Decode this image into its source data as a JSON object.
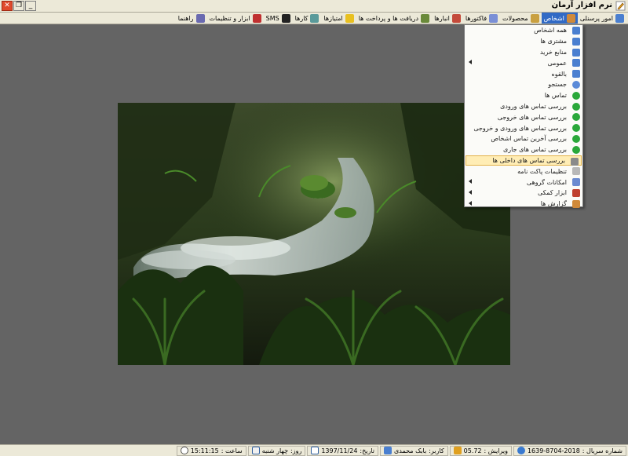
{
  "window": {
    "title": "نرم افزار آرمان",
    "close_glyph": "✕",
    "restore_glyph": "❐",
    "minimize_glyph": "_"
  },
  "menubar": {
    "items": [
      {
        "label": "امور پرسنلی",
        "icon": "people-icon",
        "color": "#4a7fd0"
      },
      {
        "label": "اشخاص",
        "icon": "people-icon",
        "color": "#d08a3a"
      },
      {
        "label": "محصولات",
        "icon": "box-icon",
        "color": "#c9a040"
      },
      {
        "label": "فاکتورها",
        "icon": "invoice-icon",
        "color": "#7a8fd6"
      },
      {
        "label": "انبارها",
        "icon": "warehouse-icon",
        "color": "#c44a3a"
      },
      {
        "label": "دریافت ها و پرداخت ها",
        "icon": "money-icon",
        "color": "#6a8a3a"
      },
      {
        "label": "امتیازها",
        "icon": "star-icon",
        "color": "#e8c020"
      },
      {
        "label": "کارها",
        "icon": "tasks-icon",
        "color": "#5a9a9a"
      },
      {
        "label": "SMS",
        "icon": "sms-icon",
        "color": "#222222"
      },
      {
        "label": "ابزار و تنظیمات",
        "icon": "tools-icon",
        "color": "#c03030"
      },
      {
        "label": "راهنما",
        "icon": "help-icon",
        "color": "#6a6ab0"
      }
    ]
  },
  "dropdown": {
    "items": [
      {
        "label": "همه اشخاص",
        "icon": "people-icon",
        "color": "#4a7fd0",
        "submenu": false
      },
      {
        "label": "مشتری ها",
        "icon": "people-icon",
        "color": "#4a7fd0",
        "submenu": false
      },
      {
        "label": "منابع خرید",
        "icon": "people-icon",
        "color": "#4a7fd0",
        "submenu": false
      },
      {
        "label": "عمومی",
        "icon": "people-icon",
        "color": "#4a7fd0",
        "submenu": true
      },
      {
        "label": "بالقوه",
        "icon": "people-icon",
        "color": "#4a7fd0",
        "submenu": false
      },
      {
        "label": "جستجو",
        "icon": "search-icon",
        "color": "#5a8ad8",
        "submenu": false
      },
      {
        "label": "تماس ها",
        "icon": "phone-icon",
        "color": "#2aa83a",
        "submenu": false
      },
      {
        "label": "بررسی تماس های ورودی",
        "icon": "phone-icon",
        "color": "#2aa83a",
        "submenu": false
      },
      {
        "label": "بررسی تماس های خروجی",
        "icon": "phone-icon",
        "color": "#2aa83a",
        "submenu": false
      },
      {
        "label": "بررسی تماس های ورودی و خروجی",
        "icon": "phone-icon",
        "color": "#2aa83a",
        "submenu": false
      },
      {
        "label": "بررسی آخرین تماس اشخاص",
        "icon": "phone-icon",
        "color": "#2aa83a",
        "submenu": false
      },
      {
        "label": "بررسی تماس های جاری",
        "icon": "phone-icon",
        "color": "#2aa83a",
        "submenu": false
      },
      {
        "label": "بررسی تماس های داخلی ها",
        "icon": "phone-handset-icon",
        "color": "#8a8a8a",
        "submenu": false,
        "highlighted": true
      },
      {
        "label": "تنظیمات پاکت نامه",
        "icon": "envelope-icon",
        "color": "#b8b8b8",
        "submenu": false
      },
      {
        "label": "امکانات گروهی",
        "icon": "group-icon",
        "color": "#6a8ad0",
        "submenu": true
      },
      {
        "label": "ابزار کمکی",
        "icon": "wrench-icon",
        "color": "#c04030",
        "submenu": true
      },
      {
        "label": "گزارش ها",
        "icon": "report-icon",
        "color": "#d08a3a",
        "submenu": true
      }
    ]
  },
  "statusbar": {
    "serial_label": "شماره سریال :",
    "serial_value": "1639-8704-2018",
    "version_label": "ویرایش :",
    "version_value": "05.72",
    "user_label": "کاربر:",
    "user_value": "بابک محمدی",
    "date_label": "تاریخ:",
    "date_value": "1397/11/24",
    "day_label": "روز:",
    "day_value": "چهار شنبه",
    "time_label": "ساعت :",
    "time_value": "15:11:15"
  }
}
